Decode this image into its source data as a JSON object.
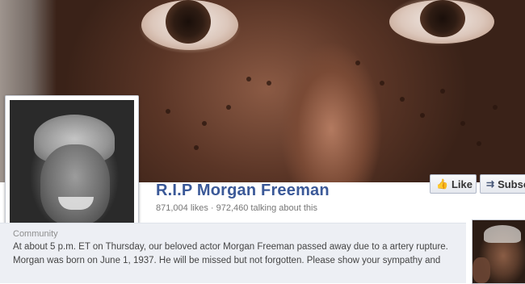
{
  "page": {
    "name": "R.I.P Morgan Freeman",
    "stats": "871,004 likes · 972,460 talking about this"
  },
  "actions": {
    "like_label": "Like",
    "subscribe_label": "Subscribe"
  },
  "about": {
    "category": "Community",
    "lines": [
      "At about 5 p.m. ET on Thursday, our beloved actor Morgan Freeman passed away due to a artery rupture.",
      "Morgan was born on June 1, 1937. He will be missed but not forgotten. Please show your sympathy and"
    ]
  },
  "icons": {
    "like": "thumbs-up-icon",
    "subscribe": "rss-feed-icon"
  },
  "colors": {
    "page_name": "#3b5998",
    "about_background": "#edeff4"
  }
}
